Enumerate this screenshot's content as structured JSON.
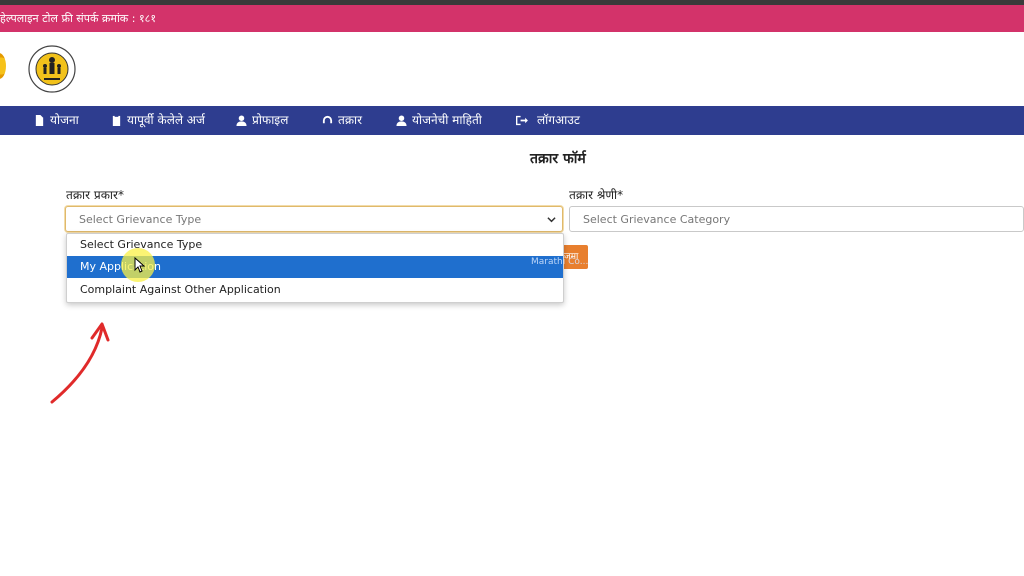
{
  "helpline": {
    "text": "हेल्पलाइन टोल फ्री संपर्क क्रमांक : १८१"
  },
  "nav": {
    "items": [
      {
        "label": "योजना",
        "icon": "document-icon"
      },
      {
        "label": "यापूर्वी केलेले अर्ज",
        "icon": "clipboard-icon"
      },
      {
        "label": "प्रोफाइल",
        "icon": "user-icon"
      },
      {
        "label": "तक्रार",
        "icon": "headset-icon"
      },
      {
        "label": "योजनेची माहिती",
        "icon": "user-icon"
      },
      {
        "label": "लॉगआउट",
        "icon": "logout-icon"
      }
    ]
  },
  "form": {
    "title": "तक्रार फॉर्म",
    "type_label": "तक्रार प्रकार*",
    "type_value": "Select Grievance Type",
    "category_label": "तक्रार श्रेणी*",
    "category_value": "Select Grievance Category",
    "dropdown_options": [
      "Select Grievance Type",
      "My Application",
      "Complaint Against Other Application"
    ],
    "highlighted_option": "My Application",
    "submit_label": "जमा",
    "overlay_text": "Marathi Co..."
  },
  "colors": {
    "helpline_bg": "#d3336a",
    "navbar_bg": "#2e3d8f",
    "highlight": "#1f6fce",
    "button": "#e87f2e",
    "annotation_arrow": "#e02a2a"
  }
}
